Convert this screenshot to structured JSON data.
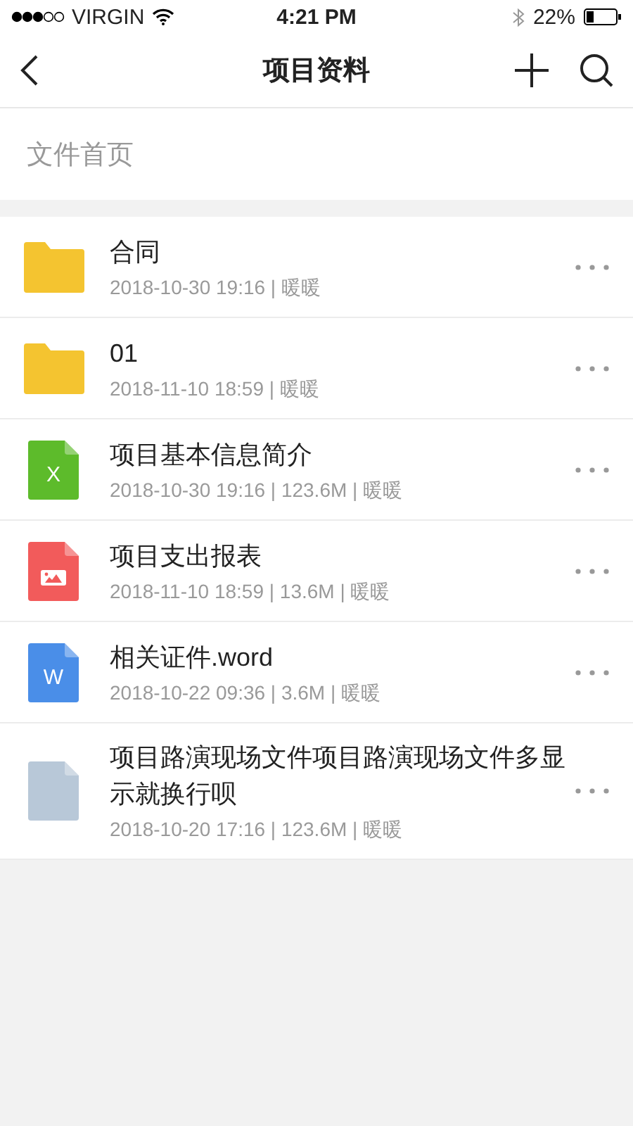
{
  "status_bar": {
    "carrier": "VIRGIN",
    "time": "4:21 PM",
    "battery": "22%"
  },
  "nav": {
    "title": "项目资料"
  },
  "breadcrumb": "文件首页",
  "files": [
    {
      "kind": "folder",
      "name": "合同",
      "meta": "2018-10-30 19:16 | 暖暖"
    },
    {
      "kind": "folder",
      "name": "01",
      "meta": "2018-11-10 18:59 | 暖暖"
    },
    {
      "kind": "excel",
      "badge": "X",
      "name": "项目基本信息简介",
      "meta": "2018-10-30 19:16 | 123.6M | 暖暖"
    },
    {
      "kind": "image",
      "name": "项目支出报表",
      "meta": "2018-11-10 18:59 | 13.6M | 暖暖"
    },
    {
      "kind": "word",
      "badge": "W",
      "name": "相关证件.word",
      "meta": "2018-10-22 09:36 | 3.6M | 暖暖"
    },
    {
      "kind": "file",
      "name": "项目路演现场文件项目路演现场文件多显示就换行呗",
      "meta": "2018-10-20 17:16 | 123.6M | 暖暖"
    }
  ]
}
